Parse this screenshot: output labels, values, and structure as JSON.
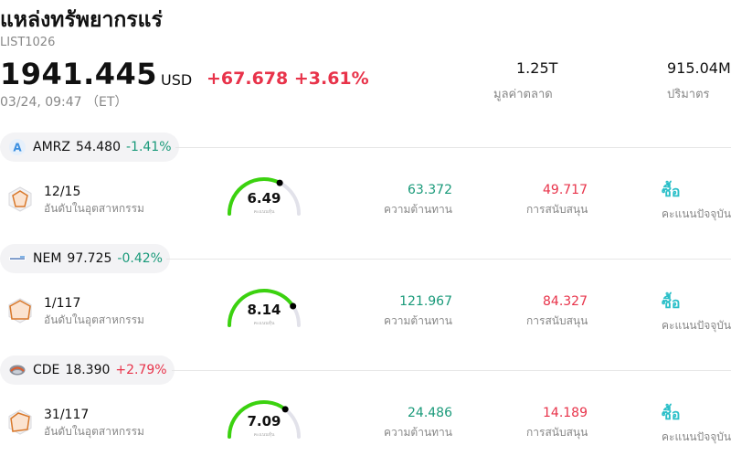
{
  "header": {
    "title": "แหล่งทรัพยากรแร่",
    "code": "LIST1026",
    "price": "1941.445",
    "currency": "USD",
    "change": "+67.678 +3.61%",
    "time": "03/24, 09:47 （ET）",
    "market_cap_value": "1.25T",
    "market_cap_label": "มูลค่าตลาด",
    "volume_value": "915.04M",
    "volume_label": "ปริมาตร"
  },
  "colors": {
    "up": "#e8334a",
    "down": "#1a9a7a",
    "buy": "#2bbfc8",
    "gauge_green": "#3bd20f"
  },
  "stocks": [
    {
      "symbol": "AMRZ",
      "price": "54.480",
      "change_pct": "-1.41%",
      "logo": "amrz-logo-icon",
      "rank": "12/15",
      "rank_label": "อันดับในอุตสาหกรรม",
      "score": "6.49",
      "score_fraction": 0.649,
      "score_sublabel": "คะแนนหุ้น",
      "resistance": "63.372",
      "resistance_label": "ความต้านทาน",
      "support": "49.717",
      "support_label": "การสนับสนุน",
      "action": "ซื้อ",
      "action_label": "คะแนนปัจจุบัน"
    },
    {
      "symbol": "NEM",
      "price": "97.725",
      "change_pct": "-0.42%",
      "logo": "nem-logo-icon",
      "rank": "1/117",
      "rank_label": "อันดับในอุตสาหกรรม",
      "score": "8.14",
      "score_fraction": 0.814,
      "score_sublabel": "คะแนนหุ้น",
      "resistance": "121.967",
      "resistance_label": "ความต้านทาน",
      "support": "84.327",
      "support_label": "การสนับสนุน",
      "action": "ซื้อ",
      "action_label": "คะแนนปัจจุบัน"
    },
    {
      "symbol": "CDE",
      "price": "18.390",
      "change_pct": "+2.79%",
      "logo": "cde-logo-icon",
      "rank": "31/117",
      "rank_label": "อันดับในอุตสาหกรรม",
      "score": "7.09",
      "score_fraction": 0.709,
      "score_sublabel": "คะแนนหุ้น",
      "resistance": "24.486",
      "resistance_label": "ความต้านทาน",
      "support": "14.189",
      "support_label": "การสนับสนุน",
      "action": "ซื้อ",
      "action_label": "คะแนนปัจจุบัน"
    }
  ]
}
